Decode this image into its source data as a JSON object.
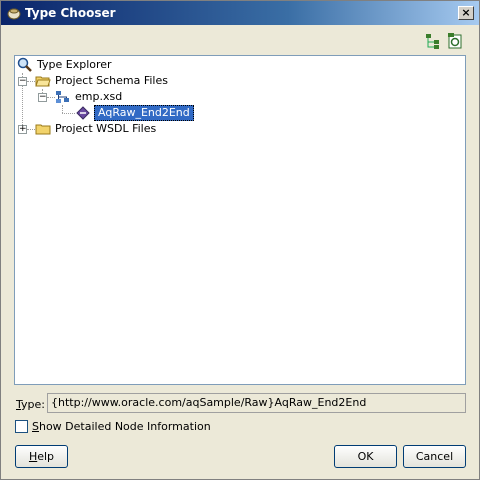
{
  "window": {
    "title": "Type Chooser",
    "close_glyph": "×"
  },
  "toolbar": {
    "icons": [
      "tree-expand-icon",
      "schema-import-icon"
    ]
  },
  "tree": {
    "root_label": "Type Explorer",
    "project_schema_label": "Project Schema Files",
    "schema_file_label": "emp.xsd",
    "element_label": "AqRaw_End2End",
    "project_wsdl_label": "Project WSDL Files"
  },
  "type_field": {
    "label_mnemonic": "T",
    "label_rest": "ype:",
    "value": "{http://www.oracle.com/aqSample/Raw}AqRaw_End2End"
  },
  "detail_checkbox": {
    "label_mnemonic": "S",
    "label_rest": "how Detailed Node Information",
    "checked": false
  },
  "buttons": {
    "help_mnemonic": "H",
    "help_rest": "elp",
    "ok": "OK",
    "cancel": "Cancel"
  },
  "colors": {
    "selection": "#316ac5",
    "title_gradient_start": "#0a246a"
  }
}
